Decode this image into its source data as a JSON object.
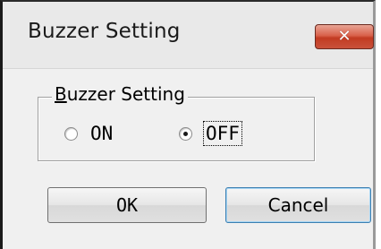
{
  "window": {
    "title": "Buzzer Setting",
    "close_icon": "close-icon",
    "close_glyph": "✕"
  },
  "group": {
    "legend_mnemonic": "B",
    "legend_rest": "uzzer Setting"
  },
  "options": [
    {
      "label": "ON",
      "checked": false
    },
    {
      "label": "OFF",
      "checked": true
    }
  ],
  "buttons": {
    "ok_label": "OK",
    "cancel_label": "Cancel"
  },
  "colors": {
    "window_bg": "#f0f0f0",
    "close_button": "#c9513a",
    "default_button_border": "#3c7fb1"
  }
}
